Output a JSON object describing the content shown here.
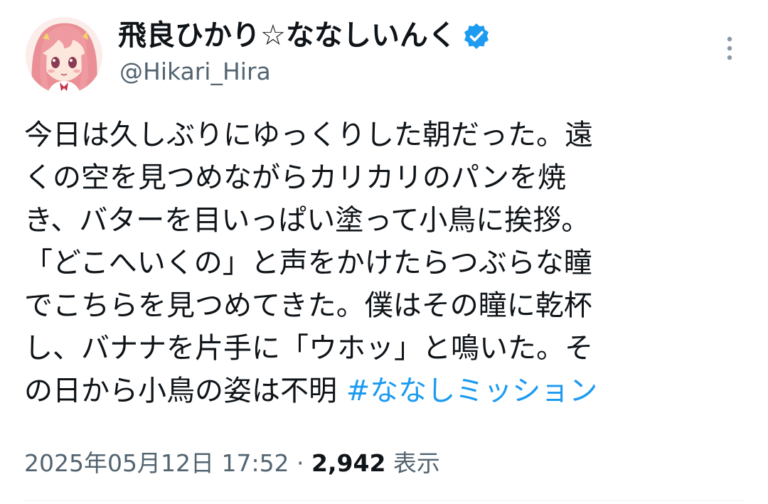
{
  "user": {
    "display_name": "飛良ひかり☆ななしいんく",
    "handle": "@Hikari_Hira",
    "verified": true,
    "avatar_icon": "anime-girl-avatar-icon"
  },
  "tweet": {
    "lines": [
      "今日は久しぶりにゆっくりした朝だった。遠",
      "くの空を見つめながらカリカリのパンを焼",
      "き、バターを目いっぱい塗って小鳥に挨拶。",
      "「どこへいくの」と声をかけたらつぶらな瞳",
      "でこちらを見つめてきた。僕はその瞳に乾杯",
      "し、バナナを片手に「ウホッ」と鳴いた。そ",
      "の日から小鳥の姿は不明 "
    ],
    "hashtag": "#ななしミッション",
    "timestamp": "2025年05月12日 17:52",
    "separator": " · ",
    "views_count": "2,942",
    "views_label": " 表示"
  },
  "colors": {
    "text": "#0f1419",
    "secondary": "#536471",
    "accent": "#1d9bf0",
    "divider": "#eff3f4"
  }
}
